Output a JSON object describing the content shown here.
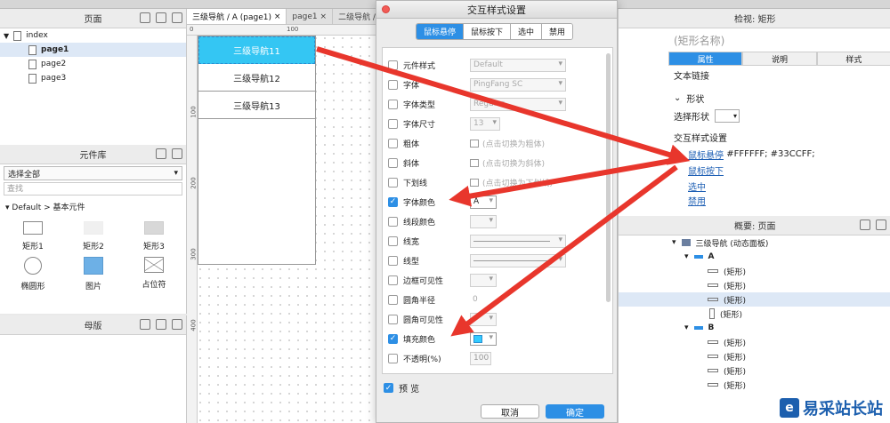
{
  "pages_panel": {
    "title": "页面",
    "items": [
      {
        "label": "index"
      },
      {
        "label": "page1"
      },
      {
        "label": "page2"
      },
      {
        "label": "page3"
      }
    ]
  },
  "widgets_panel": {
    "title": "元件库",
    "select_value": "选择全部",
    "search_placeholder": "查找",
    "group": "Default > 基本元件",
    "items": [
      {
        "label": "矩形1"
      },
      {
        "label": "矩形2"
      },
      {
        "label": "矩形3"
      },
      {
        "label": "椭圆形"
      },
      {
        "label": "图片"
      },
      {
        "label": "占位符"
      }
    ]
  },
  "masters_panel": {
    "title": "母版"
  },
  "canvas": {
    "tabs": [
      {
        "label": "三级导航 / A (page1)"
      },
      {
        "label": "page1"
      },
      {
        "label": "二级导航 / S"
      }
    ],
    "ruler_top": [
      "0",
      "100"
    ],
    "ruler_left": [
      "100",
      "200",
      "300",
      "400"
    ],
    "nav_items": [
      {
        "label": "三级导航11"
      },
      {
        "label": "三级导航12"
      },
      {
        "label": "三级导航13"
      }
    ]
  },
  "dialog": {
    "title": "交互样式设置",
    "tabs": [
      {
        "label": "鼠标悬停"
      },
      {
        "label": "鼠标按下"
      },
      {
        "label": "选中"
      },
      {
        "label": "禁用"
      }
    ],
    "rows": [
      {
        "label": "元件样式",
        "value": "Default"
      },
      {
        "label": "字体",
        "value": "PingFang SC"
      },
      {
        "label": "字体类型",
        "value": "Regular"
      },
      {
        "label": "字体尺寸",
        "value": "13"
      },
      {
        "label": "粗体",
        "value": "(点击切换为粗体)"
      },
      {
        "label": "斜体",
        "value": "(点击切换为斜体)"
      },
      {
        "label": "下划线",
        "value": "(点击切换为下划线)"
      },
      {
        "label": "字体颜色",
        "value": "A"
      },
      {
        "label": "线段颜色",
        "value": ""
      },
      {
        "label": "线宽",
        "value": ""
      },
      {
        "label": "线型",
        "value": ""
      },
      {
        "label": "边框可见性",
        "value": ""
      },
      {
        "label": "圆角半径",
        "value": "0"
      },
      {
        "label": "圆角可见性",
        "value": ""
      },
      {
        "label": "填充颜色",
        "value": ""
      },
      {
        "label": "不透明(%)",
        "value": "100"
      }
    ],
    "preview_label": "预 览",
    "cancel_label": "取消",
    "ok_label": "确定",
    "fill_color": "#33CCFF"
  },
  "inspector": {
    "title": "检视: 矩形",
    "name_placeholder": "(矩形名称)",
    "tabs": [
      {
        "label": "属性"
      },
      {
        "label": "说明"
      },
      {
        "label": "样式"
      }
    ],
    "text_link_label": "文本链接",
    "shape_section": "形状",
    "select_shape_label": "选择形状",
    "interaction_style_label": "交互样式设置",
    "hover_link": "鼠标悬停",
    "hover_value": "#FFFFFF; #33CCFF;",
    "press_link": "鼠标按下",
    "selected_link": "选中",
    "disabled_link": "禁用"
  },
  "outline": {
    "title": "概要: 页面",
    "items": [
      {
        "label": "三级导航 (动态面板)"
      },
      {
        "label": "A"
      },
      {
        "label": "(矩形)"
      },
      {
        "label": "(矩形)"
      },
      {
        "label": "(矩形)"
      },
      {
        "label": "(矩形)"
      },
      {
        "label": "B"
      },
      {
        "label": "(矩形)"
      },
      {
        "label": "(矩形)"
      },
      {
        "label": "(矩形)"
      },
      {
        "label": "(矩形)"
      }
    ]
  },
  "watermark": {
    "logo": "e",
    "text": "易采站长站"
  },
  "colors": {
    "accent": "#2d8fe5",
    "nav_highlight": "#34c6f3",
    "arrow": "#e8362c"
  }
}
